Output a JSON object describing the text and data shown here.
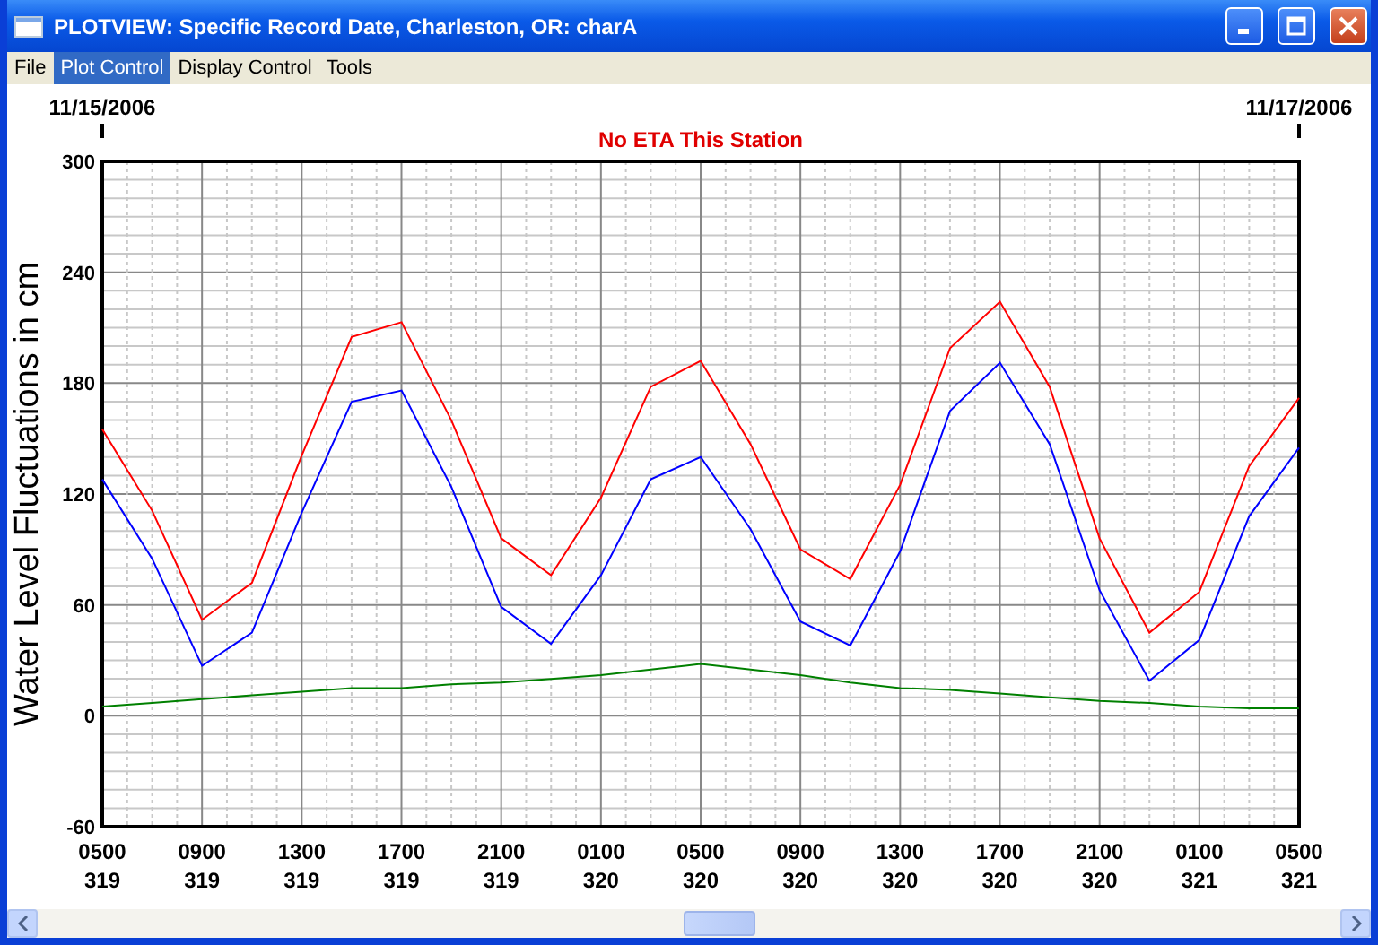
{
  "window": {
    "title": "PLOTVIEW: Specific Record Date, Charleston, OR: charA"
  },
  "menu": [
    {
      "label": "File",
      "selected": false
    },
    {
      "label": "Plot Control",
      "selected": true
    },
    {
      "label": "Display Control",
      "selected": false
    },
    {
      "label": "Tools",
      "selected": false
    }
  ],
  "plot": {
    "date_start": "11/15/2006",
    "date_end": "11/17/2006",
    "chart_data": {
      "type": "line",
      "title": "No ETA This Station",
      "ylabel": "Water Level Fluctuations in cm",
      "categories": [
        "0500\n319",
        null,
        "0900\n319",
        null,
        "1300\n319",
        null,
        "1700\n319",
        null,
        "2100\n319",
        null,
        "0100\n320",
        null,
        "0500\n320",
        null,
        "0900\n320",
        null,
        "1300\n320",
        null,
        "1700\n320",
        null,
        "2100\n320",
        null,
        "0100\n321",
        null,
        "0500\n321"
      ],
      "ylim": [
        -60,
        300
      ],
      "grid": true,
      "yticks": [
        -60,
        0,
        60,
        120,
        180,
        240,
        300
      ],
      "series": [
        {
          "color": "#ff0000",
          "values": [
            155,
            111,
            52,
            72,
            141,
            205,
            213,
            160,
            96,
            76,
            118,
            178,
            192,
            147,
            90,
            74,
            125,
            199,
            224,
            178,
            96,
            45,
            67,
            135,
            172
          ]
        },
        {
          "color": "#0000ff",
          "values": [
            128,
            85,
            27,
            45,
            110,
            170,
            176,
            124,
            59,
            39,
            76,
            128,
            140,
            101,
            51,
            38,
            89,
            165,
            191,
            147,
            68,
            19,
            41,
            108,
            145
          ]
        },
        {
          "color": "#008000",
          "values": [
            5,
            7,
            9,
            11,
            13,
            15,
            15,
            17,
            18,
            20,
            22,
            25,
            28,
            25,
            22,
            18,
            15,
            14,
            12,
            10,
            8,
            7,
            5,
            4,
            4
          ]
        }
      ]
    }
  }
}
